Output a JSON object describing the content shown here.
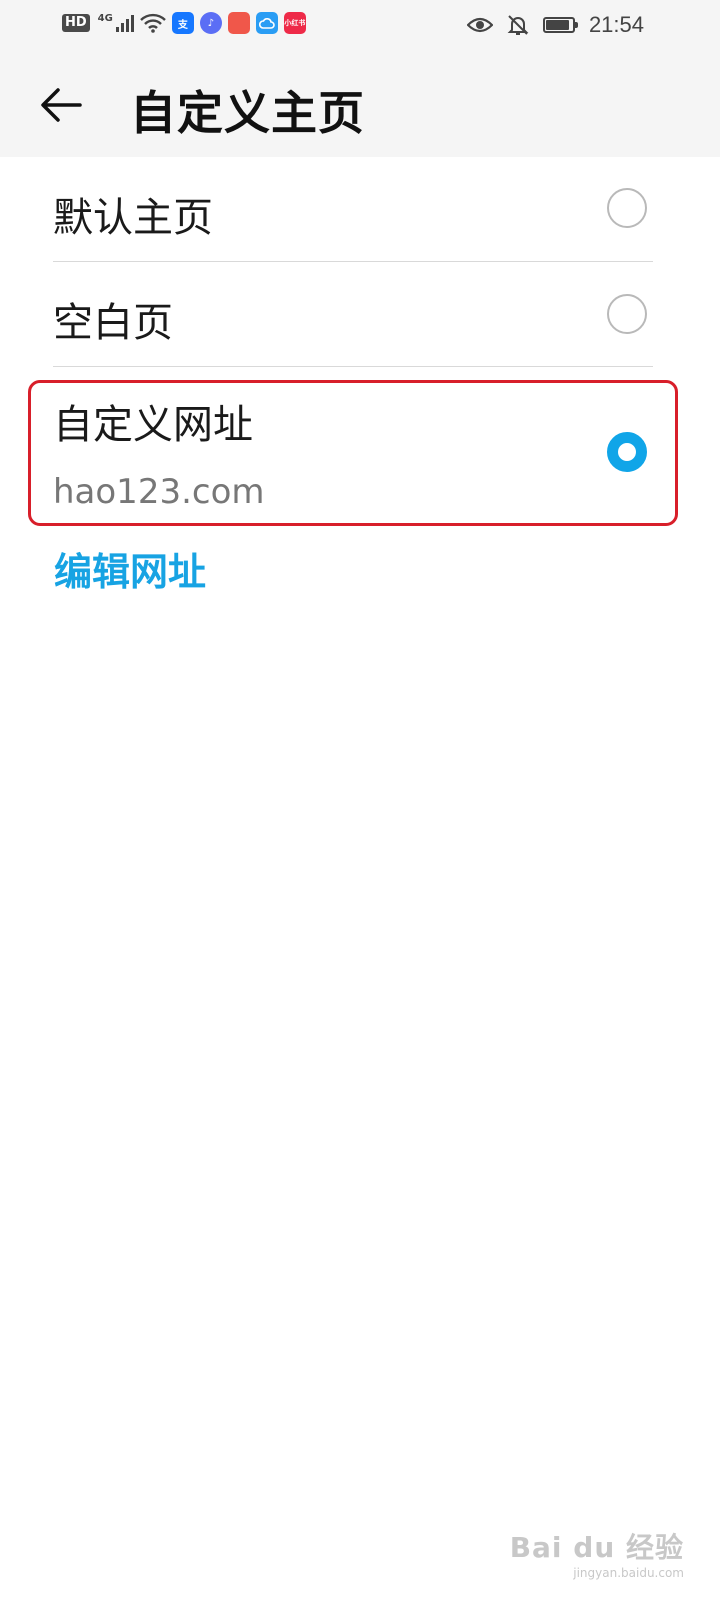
{
  "status_bar": {
    "network_badge": "HD",
    "network_type": "4G",
    "app_icons": [
      {
        "name": "alipay-icon",
        "text": "支",
        "color": "#1677ff"
      },
      {
        "name": "music-icon",
        "text": "♪",
        "color": "#5b6ef5"
      },
      {
        "name": "shopping-bag-icon",
        "text": "",
        "color": "#f0574a"
      },
      {
        "name": "cloud-drive-icon",
        "text": "",
        "color": "#2a9df4"
      },
      {
        "name": "xiaohongshu-icon",
        "text": "小红书",
        "color": "#ee2a48"
      }
    ],
    "time": "21:54",
    "battery_level": 0.9
  },
  "header": {
    "title": "自定义主页"
  },
  "options": [
    {
      "label": "默认主页",
      "selected": false
    },
    {
      "label": "空白页",
      "selected": false
    },
    {
      "label": "自定义网址",
      "sublabel": "hao123.com",
      "selected": true
    }
  ],
  "edit_link": "编辑网址",
  "watermark": {
    "main": "Bai du 经验",
    "sub": "jingyan.baidu.com"
  },
  "colors": {
    "accent": "#10a5e8",
    "highlight_border": "#d81f2a",
    "link": "#17a3e3"
  }
}
